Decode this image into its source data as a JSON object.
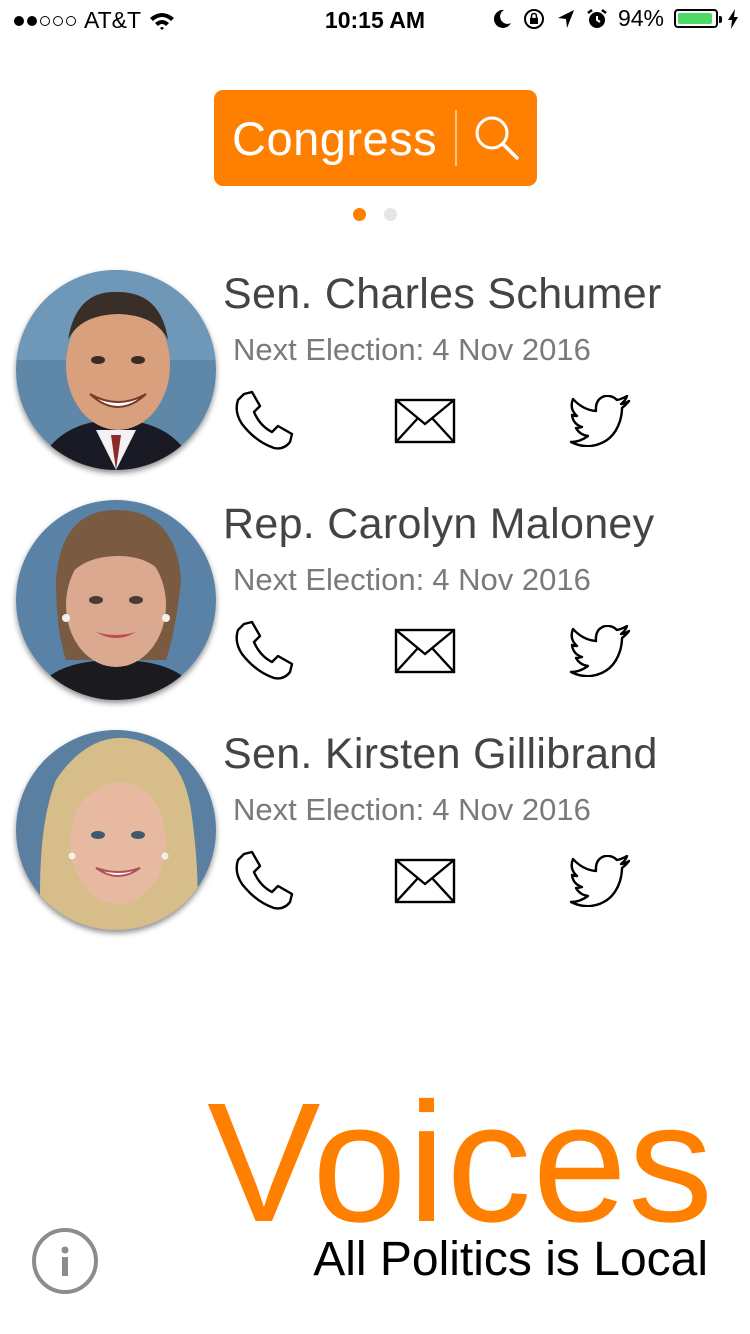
{
  "status_bar": {
    "carrier": "AT&T",
    "time": "10:15 AM",
    "battery_percent": "94%",
    "battery_level": 0.94,
    "signal_bars_filled": 2,
    "signal_bars_total": 5,
    "icons": [
      "wifi-icon",
      "moon-icon",
      "rotation-lock-icon",
      "location-arrow-icon",
      "alarm-icon",
      "battery-icon",
      "charging-bolt-icon"
    ]
  },
  "selector": {
    "label": "Congress",
    "icon": "search-icon",
    "color": "#ff8000"
  },
  "pager": {
    "pages": 2,
    "active": 1
  },
  "representatives": [
    {
      "name": "Sen. Charles Schumer",
      "election_label": "Next Election:",
      "election_date": "4 Nov 2016",
      "actions": [
        "phone-icon",
        "mail-icon",
        "twitter-icon"
      ]
    },
    {
      "name": "Rep. Carolyn Maloney",
      "election_label": "Next Election:",
      "election_date": "4 Nov 2016",
      "actions": [
        "phone-icon",
        "mail-icon",
        "twitter-icon"
      ]
    },
    {
      "name": "Sen. Kirsten Gillibrand",
      "election_label": "Next Election:",
      "election_date": "4 Nov 2016",
      "actions": [
        "phone-icon",
        "mail-icon",
        "twitter-icon"
      ]
    }
  ],
  "footer": {
    "brand": "Voices",
    "tagline": "All Politics is Local",
    "info_icon": "info-icon",
    "brand_color": "#ff8000"
  }
}
